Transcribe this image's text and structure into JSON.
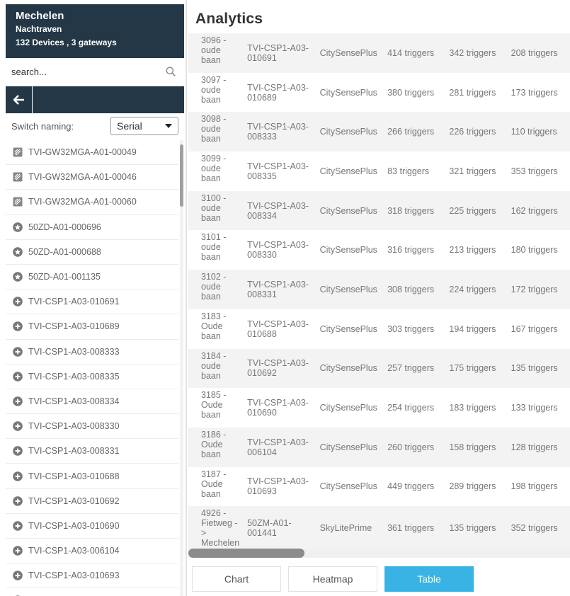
{
  "sidebar": {
    "city": "Mechelen",
    "site": "Nachtraven",
    "summary": "132 Devices , 3 gateways",
    "search_placeholder": "search...",
    "switch_label": "Switch naming:",
    "switch_value": "Serial",
    "devices": [
      {
        "name": "TVI-GW32MGA-A01-00049",
        "icon": "gateway-icon"
      },
      {
        "name": "TVI-GW32MGA-A01-00046",
        "icon": "gateway-icon"
      },
      {
        "name": "TVI-GW32MGA-A01-00060",
        "icon": "gateway-icon"
      },
      {
        "name": "50ZD-A01-000696",
        "icon": "star-badge-icon"
      },
      {
        "name": "50ZD-A01-000688",
        "icon": "star-badge-icon"
      },
      {
        "name": "50ZD-A01-001135",
        "icon": "star-badge-icon"
      },
      {
        "name": "TVI-CSP1-A03-010691",
        "icon": "plus-circle-icon"
      },
      {
        "name": "TVI-CSP1-A03-010689",
        "icon": "plus-circle-icon"
      },
      {
        "name": "TVI-CSP1-A03-008333",
        "icon": "plus-circle-icon"
      },
      {
        "name": "TVI-CSP1-A03-008335",
        "icon": "plus-circle-icon"
      },
      {
        "name": "TVI-CSP1-A03-008334",
        "icon": "plus-circle-icon"
      },
      {
        "name": "TVI-CSP1-A03-008330",
        "icon": "plus-circle-icon"
      },
      {
        "name": "TVI-CSP1-A03-008331",
        "icon": "plus-circle-icon"
      },
      {
        "name": "TVI-CSP1-A03-010688",
        "icon": "plus-circle-icon"
      },
      {
        "name": "TVI-CSP1-A03-010692",
        "icon": "plus-circle-icon"
      },
      {
        "name": "TVI-CSP1-A03-010690",
        "icon": "plus-circle-icon"
      },
      {
        "name": "TVI-CSP1-A03-006104",
        "icon": "plus-circle-icon"
      },
      {
        "name": "TVI-CSP1-A03-010693",
        "icon": "plus-circle-icon"
      },
      {
        "name": "50ZM-A01-001441",
        "icon": "star-badge-icon"
      }
    ]
  },
  "main": {
    "title": "Analytics",
    "rows": [
      {
        "location": "3096 - oude baan",
        "serial": "TVI-CSP1-A03-010691",
        "type": "CitySensePlus",
        "t1": "414 triggers",
        "t2": "342 triggers",
        "t3": "208 triggers"
      },
      {
        "location": "3097 - oude baan",
        "serial": "TVI-CSP1-A03-010689",
        "type": "CitySensePlus",
        "t1": "380 triggers",
        "t2": "281 triggers",
        "t3": "173 triggers"
      },
      {
        "location": "3098 - oude baan",
        "serial": "TVI-CSP1-A03-008333",
        "type": "CitySensePlus",
        "t1": "266 triggers",
        "t2": "226 triggers",
        "t3": "110 triggers"
      },
      {
        "location": "3099 - oude baan",
        "serial": "TVI-CSP1-A03-008335",
        "type": "CitySensePlus",
        "t1": "83 triggers",
        "t2": "321 triggers",
        "t3": "353 triggers"
      },
      {
        "location": "3100 - oude baan",
        "serial": "TVI-CSP1-A03-008334",
        "type": "CitySensePlus",
        "t1": "318 triggers",
        "t2": "225 triggers",
        "t3": "162 triggers"
      },
      {
        "location": "3101 - oude baan",
        "serial": "TVI-CSP1-A03-008330",
        "type": "CitySensePlus",
        "t1": "316 triggers",
        "t2": "213 triggers",
        "t3": "180 triggers"
      },
      {
        "location": "3102 - oude baan",
        "serial": "TVI-CSP1-A03-008331",
        "type": "CitySensePlus",
        "t1": "308 triggers",
        "t2": "224 triggers",
        "t3": "172 triggers"
      },
      {
        "location": "3183 - Oude baan",
        "serial": "TVI-CSP1-A03-010688",
        "type": "CitySensePlus",
        "t1": "303 triggers",
        "t2": "194 triggers",
        "t3": "167 triggers"
      },
      {
        "location": "3184 - oude baan",
        "serial": "TVI-CSP1-A03-010692",
        "type": "CitySensePlus",
        "t1": "257 triggers",
        "t2": "175 triggers",
        "t3": "135 triggers"
      },
      {
        "location": "3185 - Oude baan",
        "serial": "TVI-CSP1-A03-010690",
        "type": "CitySensePlus",
        "t1": "254 triggers",
        "t2": "183 triggers",
        "t3": "133 triggers"
      },
      {
        "location": "3186 - Oude baan",
        "serial": "TVI-CSP1-A03-006104",
        "type": "CitySensePlus",
        "t1": "260 triggers",
        "t2": "158 triggers",
        "t3": "128 triggers"
      },
      {
        "location": "3187 - Oude baan",
        "serial": "TVI-CSP1-A03-010693",
        "type": "CitySensePlus",
        "t1": "449 triggers",
        "t2": "289 triggers",
        "t3": "198 triggers"
      },
      {
        "location": "4926 - Fietweg - > Mechelen",
        "serial": "50ZM-A01-001441",
        "type": "SkyLitePrime",
        "t1": "361 triggers",
        "t2": "135 triggers",
        "t3": "352 triggers"
      }
    ],
    "tabs": [
      {
        "label": "Chart",
        "active": false
      },
      {
        "label": "Heatmap",
        "active": false
      },
      {
        "label": "Table",
        "active": true
      }
    ]
  },
  "colors": {
    "header_bg": "#243746",
    "accent": "#39b3e3",
    "icon_gray": "#777777"
  }
}
